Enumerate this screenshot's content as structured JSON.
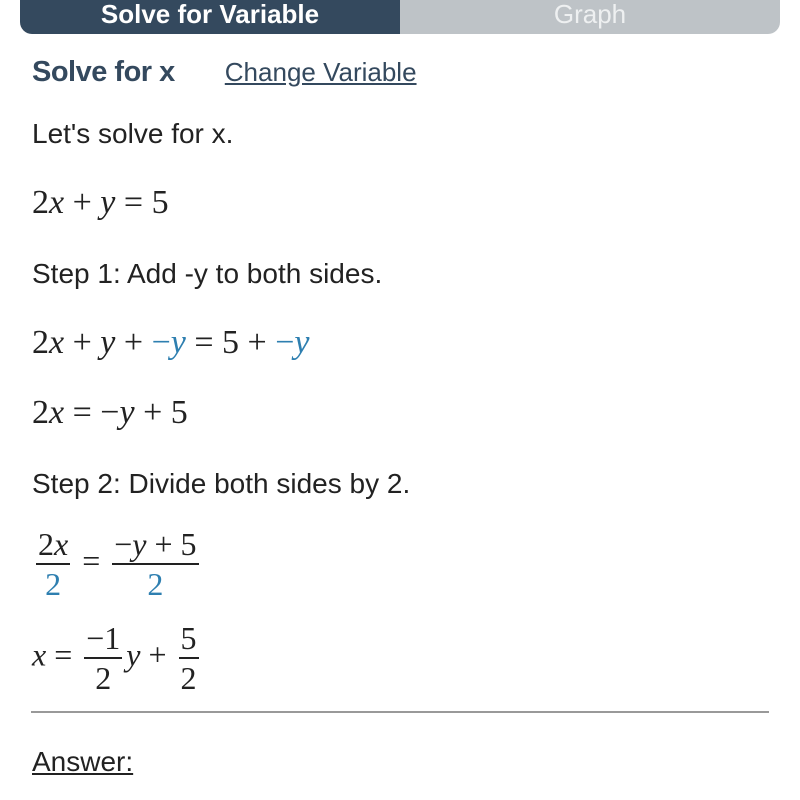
{
  "tabs": [
    {
      "label": "Solve for Variable",
      "active": true
    },
    {
      "label": "Graph",
      "active": false
    }
  ],
  "header": {
    "title": "Solve for x",
    "change_link": "Change Variable"
  },
  "intro": "Let's solve for x.",
  "equation": {
    "a": "2",
    "x": "x",
    "plus": "+",
    "y": "y",
    "eq": "=",
    "rhs": "5"
  },
  "step1": {
    "label": "Step 1: Add -y to both sides.",
    "line1": {
      "left": "2",
      "x": "x",
      "p1": " + ",
      "y": "y",
      "p2": " + ",
      "neg": "−",
      "ny": "y",
      "eq": " = ",
      "five": "5",
      "p3": " + ",
      "neg2": "−",
      "ny2": "y"
    },
    "line2": {
      "left": "2",
      "x": "x",
      "eq": " = ",
      "neg": "−",
      "y": "y",
      "rest": " + 5"
    }
  },
  "step2": {
    "label": "Step 2: Divide both sides by 2.",
    "frac_left": {
      "num_coef": "2",
      "num_var": "x",
      "den": "2"
    },
    "eq": "=",
    "frac_right": {
      "num_neg": "−",
      "num_var": "y",
      "num_rest": " + 5",
      "den": "2"
    },
    "result": {
      "var": "x",
      "eq": " = ",
      "frac1": {
        "num": "−1",
        "den": "2"
      },
      "yvar": "y",
      "plus": " + ",
      "frac2": {
        "num": "5",
        "den": "2"
      }
    }
  },
  "answer_label": "Answer:",
  "colors": {
    "primary": "#34495e",
    "inactive_tab": "#bec3c7",
    "highlight": "#2e7fb0"
  }
}
